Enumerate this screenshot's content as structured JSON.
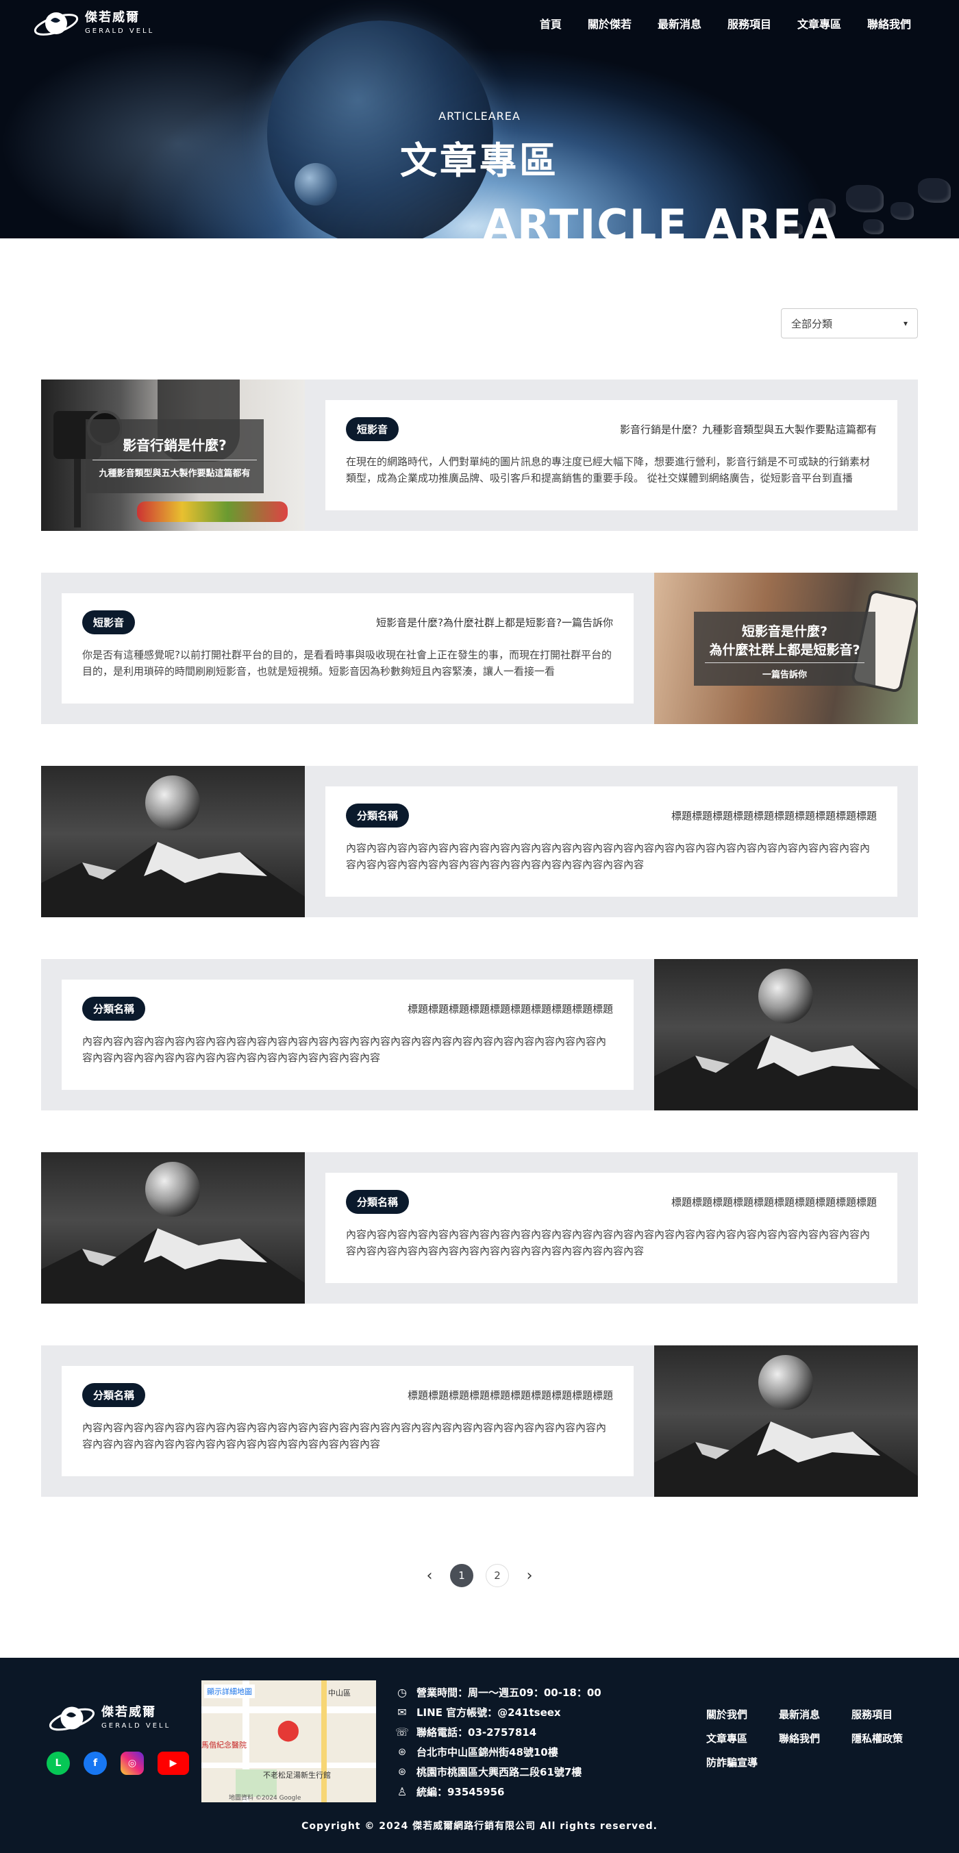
{
  "header": {
    "logo_cn": "傑若威爾",
    "logo_en": "GERALD VELL",
    "nav": [
      "首頁",
      "關於傑若",
      "最新消息",
      "服務項目",
      "文章專區",
      "聯絡我們"
    ]
  },
  "hero": {
    "subtitle": "ARTICLEAREA",
    "title": "文章專區",
    "big_text": "ARTICLE AREA"
  },
  "filter": {
    "selected": "全部分類"
  },
  "articles": [
    {
      "category": "短影音",
      "title": "影音行銷是什麼？九種影音類型與五大製作要點這篇都有",
      "excerpt": "在現在的網路時代，人們對單純的圖片訊息的專注度已經大幅下降，想要進行營利，影音行銷是不可或缺的行銷素材類型，成為企業成功推廣品牌、吸引客戶和提高銷售的重要手段。 從社交媒體到網絡廣告，從短影音平台到直播",
      "image_title": "影音行銷是什麼?",
      "image_sub": "九種影音類型與五大製作要點這篇都有"
    },
    {
      "category": "短影音",
      "title": "短影音是什麼?為什麼社群上都是短影音?一篇告訴你",
      "excerpt": "你是否有這種感覺呢?以前打開社群平台的目的，是看看時事與吸收現在社會上正在發生的事，而現在打開社群平台的目的，是利用瑣碎的時間刷刷短影音，也就是短視頻。短影音因為秒數夠短且內容緊湊，讓人一看接一看",
      "image_title": "短影音是什麼?",
      "image_title2": "為什麼社群上都是短影音?",
      "image_sub": "一篇告訴你"
    },
    {
      "category": "分類名稱",
      "title": "標題標題標題標題標題標題標題標題標題標題",
      "excerpt": "內容內容內容內容內容內容內容內容內容內容內容內容內容內容內容內容內容內容內容內容內容內容內容內容內容內容內容內容內容內容內容內容內容內容內容內容內容內容內容內容"
    },
    {
      "category": "分類名稱",
      "title": "標題標題標題標題標題標題標題標題標題標題",
      "excerpt": "內容內容內容內容內容內容內容內容內容內容內容內容內容內容內容內容內容內容內容內容內容內容內容內容內容內容內容內容內容內容內容內容內容內容內容內容內容內容內容內容"
    },
    {
      "category": "分類名稱",
      "title": "標題標題標題標題標題標題標題標題標題標題",
      "excerpt": "內容內容內容內容內容內容內容內容內容內容內容內容內容內容內容內容內容內容內容內容內容內容內容內容內容內容內容內容內容內容內容內容內容內容內容內容內容內容內容內容"
    },
    {
      "category": "分類名稱",
      "title": "標題標題標題標題標題標題標題標題標題標題",
      "excerpt": "內容內容內容內容內容內容內容內容內容內容內容內容內容內容內容內容內容內容內容內容內容內容內容內容內容內容內容內容內容內容內容內容內容內容內容內容內容內容內容內容"
    }
  ],
  "pagination": {
    "prev": "‹",
    "next": "›",
    "pages": [
      "1",
      "2"
    ],
    "current": "1"
  },
  "footer": {
    "logo_cn": "傑若威爾",
    "logo_en": "GERALD VELL",
    "socials": [
      "line-icon",
      "facebook-icon",
      "instagram-icon",
      "youtube-icon"
    ],
    "map": {
      "link": "顯示詳細地圖",
      "street": "中山區",
      "hospital": "馬偕紀念醫院",
      "poi": "不老松足湯新生行館",
      "credits": "地圖資料 ©2024 Google"
    },
    "info": [
      {
        "icon": "clock-icon",
        "text": "營業時間：周一～週五09：00-18：00"
      },
      {
        "icon": "mail-icon",
        "text": "LINE 官方帳號：@241tseex"
      },
      {
        "icon": "phone-icon",
        "text": "聯絡電話：03-2757814"
      },
      {
        "icon": "location-icon",
        "text": "台北市中山區錦州街48號10樓"
      },
      {
        "icon": "location-icon",
        "text": "桃園市桃園區大興西路二段61號7樓"
      },
      {
        "icon": "user-icon",
        "text": "統編：93545956"
      }
    ],
    "links": [
      "關於我們",
      "最新消息",
      "服務項目",
      "文章專區",
      "聯絡我們",
      "隱私權政策",
      "防詐騙宣導"
    ],
    "copyright": "Copyright © 2024 傑若威爾網路行銷有限公司 All rights reserved."
  }
}
